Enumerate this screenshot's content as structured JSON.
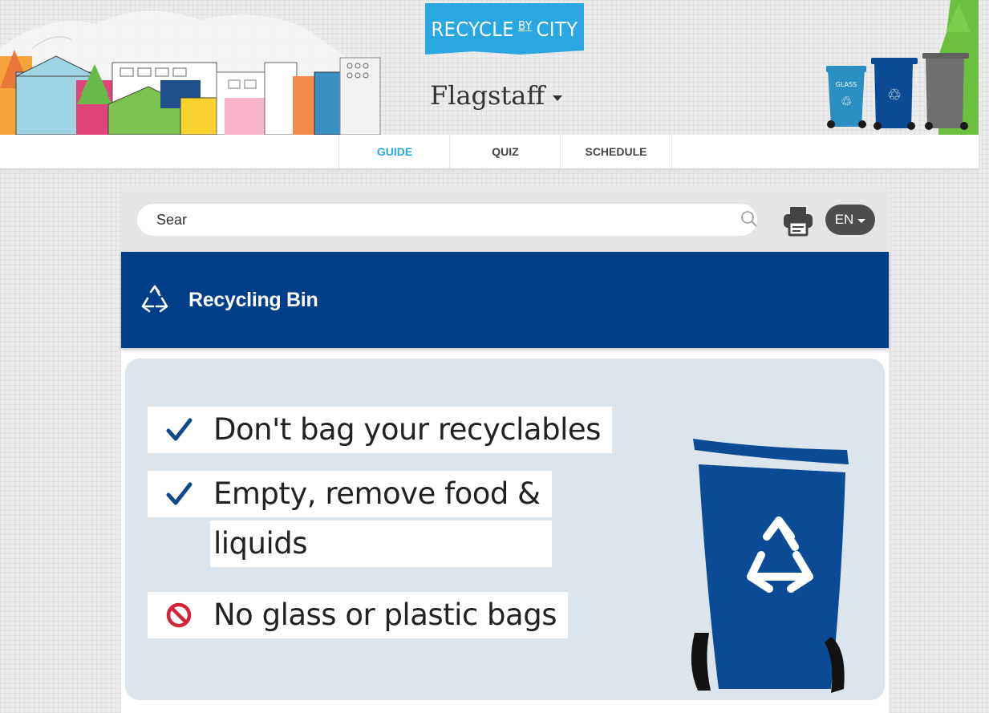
{
  "header": {
    "logo": {
      "part1": "RECYCLE",
      "part2": "BY",
      "part3": "CITY"
    },
    "city": "Flagstaff",
    "tabs": [
      {
        "label": "GUIDE",
        "active": true
      },
      {
        "label": "QUIZ",
        "active": false
      },
      {
        "label": "SCHEDULE",
        "active": false
      }
    ],
    "bins_icon_label": "GLASS"
  },
  "search": {
    "value": "Sear",
    "language": "EN"
  },
  "bin": {
    "title": "Recycling Bin",
    "color": "#003f87",
    "tips": [
      {
        "icon": "check-icon",
        "lines": [
          "Don't bag your recyclables"
        ]
      },
      {
        "icon": "check-icon",
        "lines": [
          "Empty, remove food &",
          "liquids"
        ]
      },
      {
        "icon": "no-icon",
        "lines": [
          "No glass or plastic bags"
        ]
      }
    ]
  },
  "colors": {
    "accent": "#2aa6e0",
    "recycle_blue": "#003f87",
    "check": "#0c4a8c",
    "no": "#d3243a"
  }
}
